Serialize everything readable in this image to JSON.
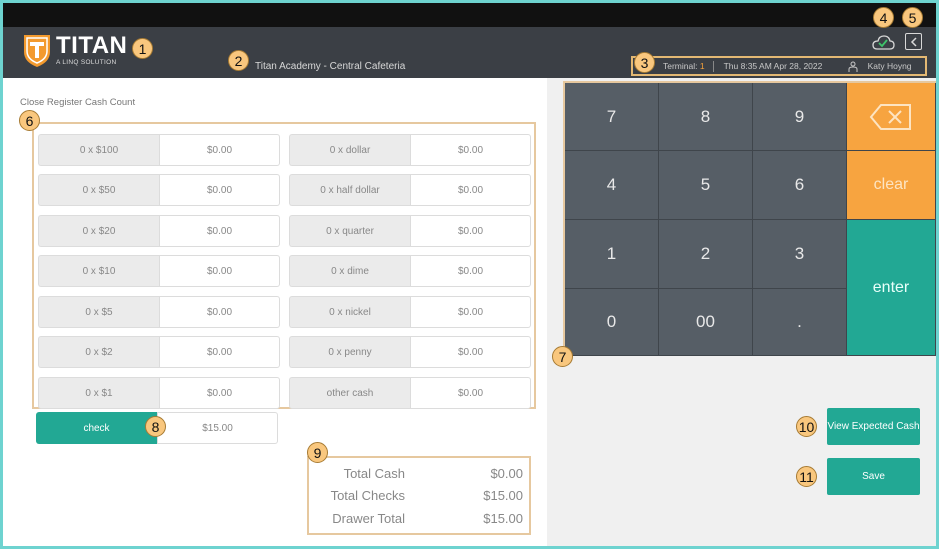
{
  "header": {
    "brand_name": "TITAN",
    "brand_sub": "A LINQ SOLUTION",
    "location": "Titan Academy - Central Cafeteria",
    "terminal_label": "Terminal:",
    "terminal_value": "1",
    "datetime": "Thu 8:35 AM Apr 28, 2022",
    "user": "Katy Hoyng"
  },
  "panel": {
    "title": "Close Register Cash Count"
  },
  "bills": [
    {
      "label": "0 x $100",
      "value": "$0.00"
    },
    {
      "label": "0 x $50",
      "value": "$0.00"
    },
    {
      "label": "0 x $20",
      "value": "$0.00"
    },
    {
      "label": "0 x $10",
      "value": "$0.00"
    },
    {
      "label": "0 x $5",
      "value": "$0.00"
    },
    {
      "label": "0 x $2",
      "value": "$0.00"
    },
    {
      "label": "0 x $1",
      "value": "$0.00"
    }
  ],
  "coins": [
    {
      "label": "0 x dollar",
      "value": "$0.00"
    },
    {
      "label": "0 x half dollar",
      "value": "$0.00"
    },
    {
      "label": "0 x quarter",
      "value": "$0.00"
    },
    {
      "label": "0 x dime",
      "value": "$0.00"
    },
    {
      "label": "0 x nickel",
      "value": "$0.00"
    },
    {
      "label": "0 x penny",
      "value": "$0.00"
    },
    {
      "label": "other cash",
      "value": "$0.00"
    }
  ],
  "check": {
    "label": "check",
    "value": "$15.00"
  },
  "totals": [
    {
      "label": "Total Cash",
      "value": "$0.00"
    },
    {
      "label": "Total Checks",
      "value": "$15.00"
    },
    {
      "label": "Drawer Total",
      "value": "$15.00"
    }
  ],
  "keypad": {
    "digits": [
      "7",
      "8",
      "9",
      "4",
      "5",
      "6",
      "1",
      "2",
      "3",
      "0",
      "00",
      "."
    ],
    "clear": "clear",
    "enter": "enter"
  },
  "buttons": {
    "view_expected": "View Expected Cash",
    "save": "Save"
  },
  "callouts": [
    "1",
    "2",
    "3",
    "4",
    "5",
    "6",
    "7",
    "8",
    "9",
    "10",
    "11"
  ],
  "colors": {
    "accent_green": "#22a894",
    "accent_orange": "#f7a440",
    "header_bg": "#3b3f45",
    "callout": "#f9c77e"
  }
}
